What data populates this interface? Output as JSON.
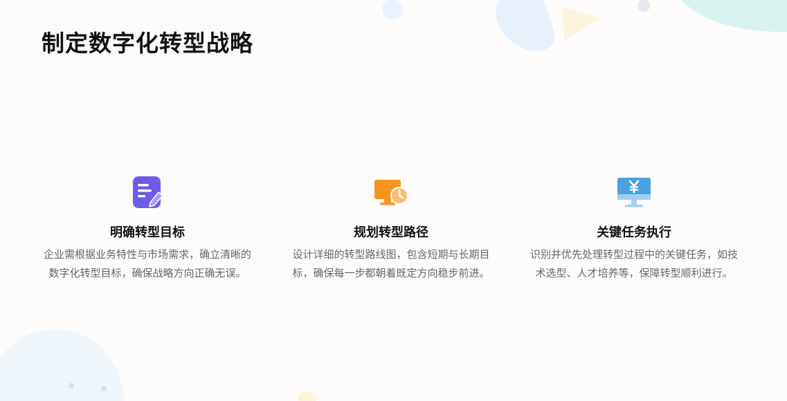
{
  "page": {
    "title": "制定数字化转型战略"
  },
  "colors": {
    "icon_purple": "#6c5ce7",
    "icon_orange": "#f7931e",
    "icon_blue": "#4aa3e0",
    "title_text": "#111111",
    "body_text": "#666666"
  },
  "features": [
    {
      "icon": "edit-document-icon",
      "title": "明确转型目标",
      "description": "企业需根据业务特性与市场需求，确立清晰的数字化转型目标，确保战略方向正确无误。"
    },
    {
      "icon": "monitor-clock-icon",
      "title": "规划转型路径",
      "description": "设计详细的转型路线图，包含短期与长期目标，确保每一步都朝着既定方向稳步前进。"
    },
    {
      "icon": "monitor-yuan-icon",
      "title": "关键任务执行",
      "description": "识别并优先处理转型过程中的关键任务，如技术选型、人才培养等，保障转型顺利进行。"
    }
  ]
}
